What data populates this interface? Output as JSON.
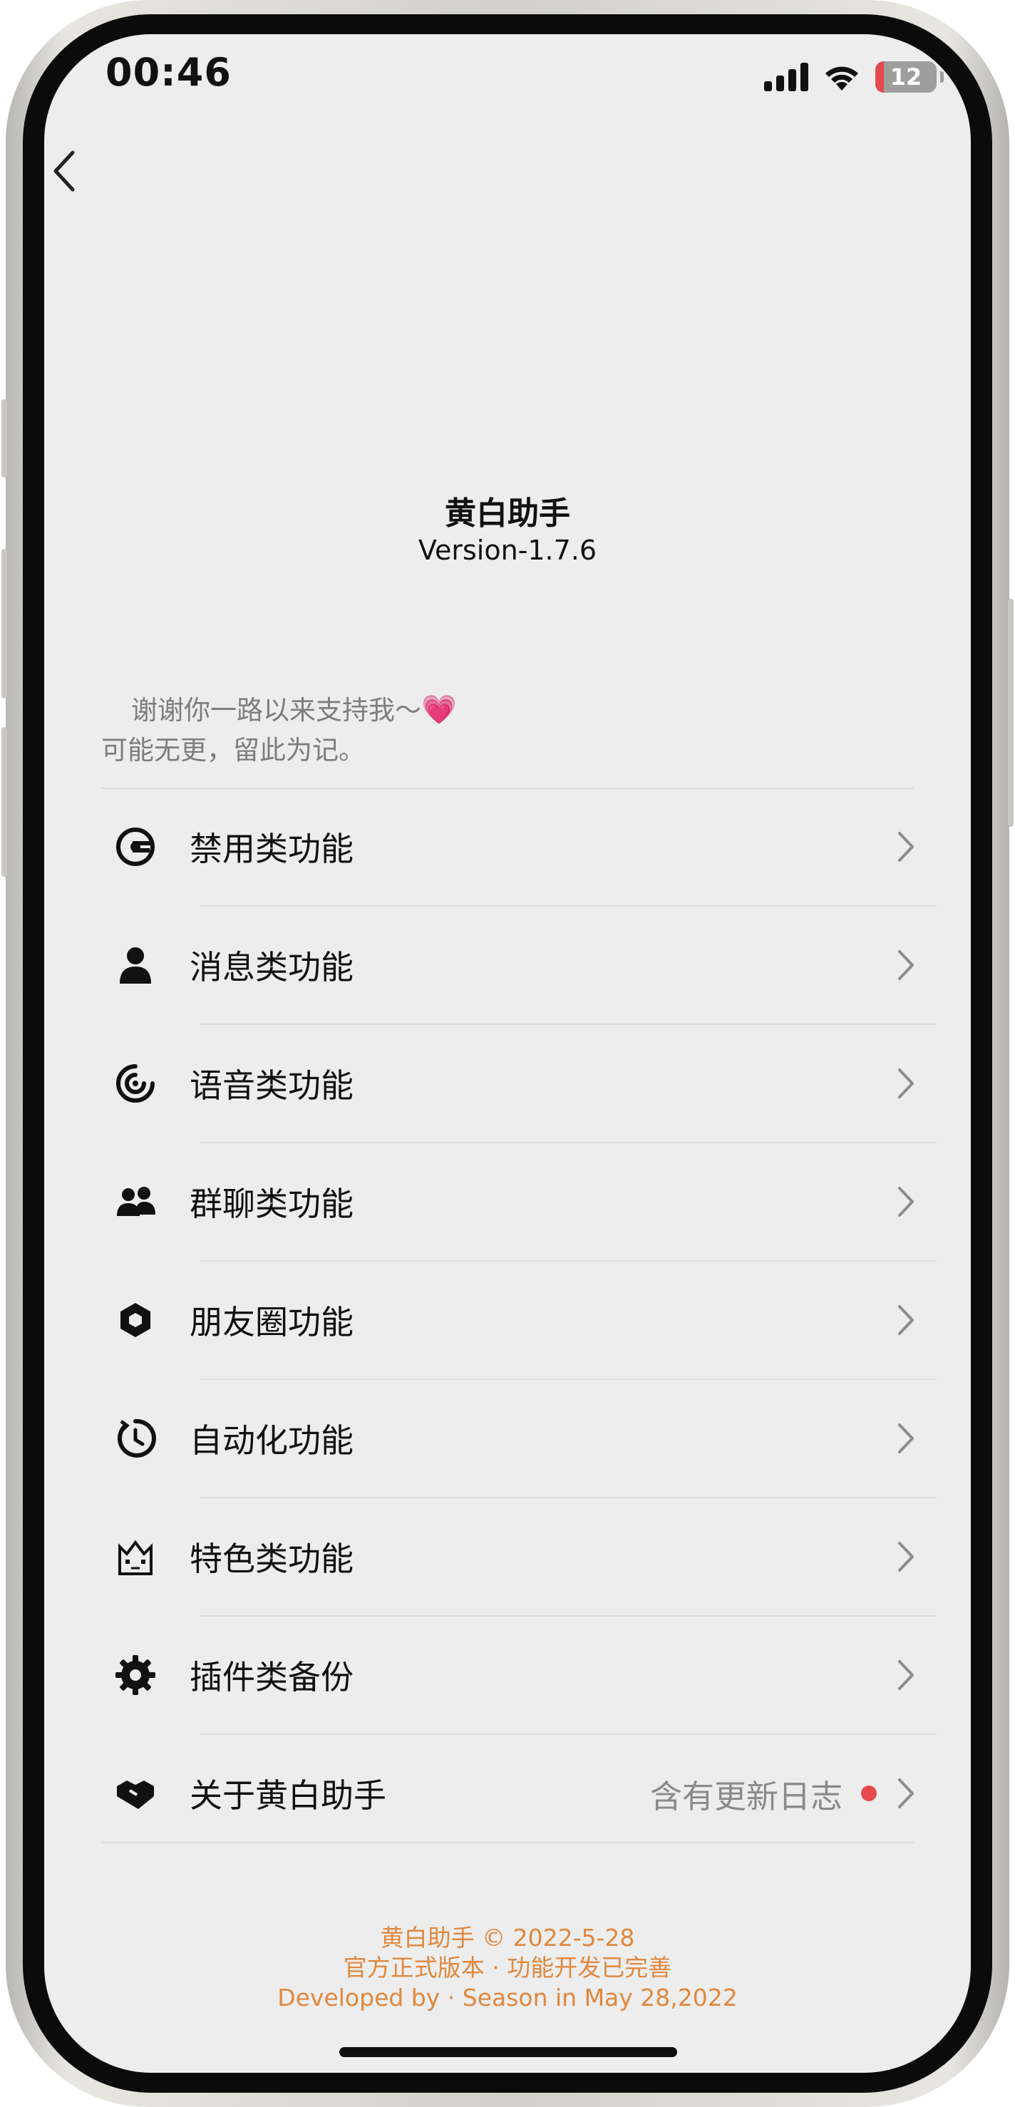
{
  "status_bar": {
    "time": "00:46",
    "battery": "12",
    "icons": [
      "cellular-signal-icon",
      "wifi-icon",
      "battery-icon"
    ]
  },
  "nav": {
    "back_icon": "chevron-left-icon"
  },
  "header": {
    "title": "黄白助手",
    "version": "Version-1.7.6"
  },
  "thanks": {
    "line1": "谢谢你一路以来支持我～",
    "emoji": "💗",
    "line2": "可能无更，留此为记。"
  },
  "menu": [
    {
      "label": "禁用类功能",
      "icon": "disable-icon"
    },
    {
      "label": "消息类功能",
      "icon": "user-icon"
    },
    {
      "label": "语音类功能",
      "icon": "voice-icon"
    },
    {
      "label": "群聊类功能",
      "icon": "group-icon"
    },
    {
      "label": "朋友圈功能",
      "icon": "moments-icon"
    },
    {
      "label": "自动化功能",
      "icon": "auto-timer-icon"
    },
    {
      "label": "特色类功能",
      "icon": "cat-icon"
    },
    {
      "label": "插件类备份",
      "icon": "gear-icon"
    },
    {
      "label": "关于黄白助手",
      "icon": "handshake-icon",
      "extra": "含有更新日志",
      "badge_color": "#e5484d"
    }
  ],
  "footer": {
    "line1": "黄白助手 © 2022-5-28",
    "line2": "官方正式版本 · 功能开发已完善",
    "line3": "Developed by · Season in May 28,2022"
  },
  "colors": {
    "accent": "#e0883e",
    "badge": "#e5484d",
    "background": "#ededed"
  }
}
